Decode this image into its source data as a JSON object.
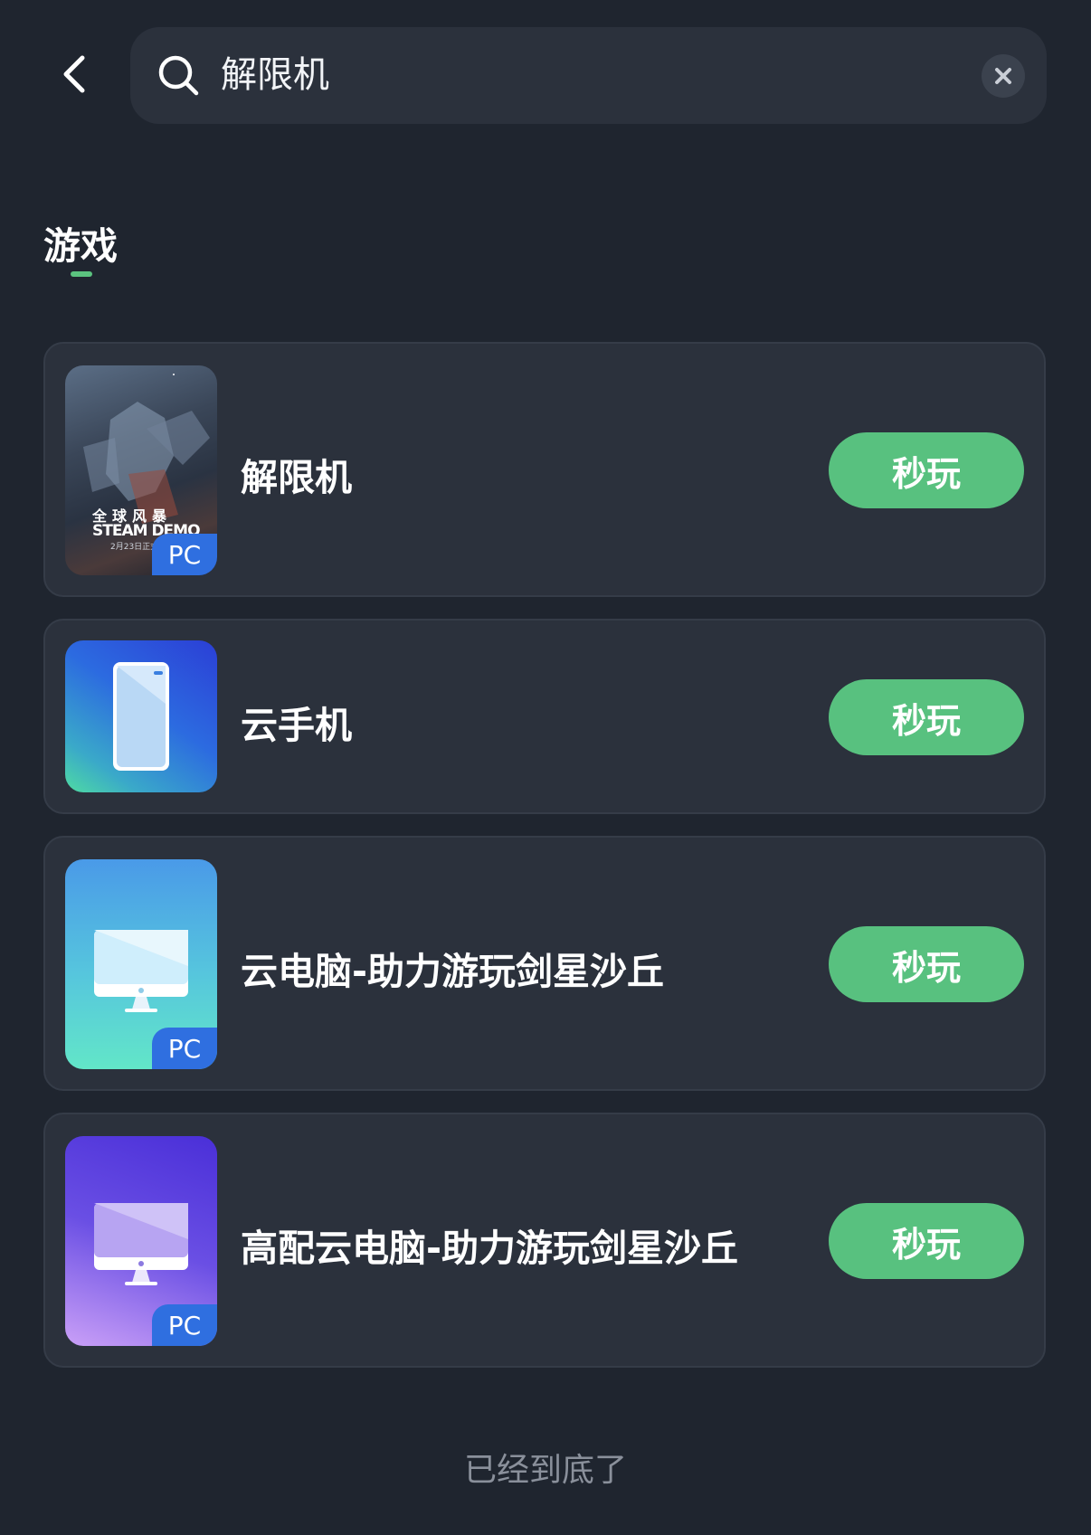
{
  "search": {
    "value": "解限机"
  },
  "tabs": [
    {
      "label": "游戏",
      "active": true
    }
  ],
  "colors": {
    "background": "#1f252f",
    "card": "#2b313c",
    "accent": "#58c17f",
    "pc_badge": "#2f6fe0"
  },
  "results": [
    {
      "name": "解限机",
      "button": "秒玩",
      "badge": "PC",
      "thumb_icon": "game-poster-icon",
      "poster_text": [
        "全球风暴",
        "STEAM DEMO",
        "2月23日正式"
      ]
    },
    {
      "name": "云手机",
      "button": "秒玩",
      "badge": "",
      "thumb_icon": "phone-icon"
    },
    {
      "name": "云电脑-助力游玩剑星沙丘",
      "button": "秒玩",
      "badge": "PC",
      "thumb_icon": "desktop-monitor-icon"
    },
    {
      "name": "高配云电脑-助力游玩剑星沙丘",
      "button": "秒玩",
      "badge": "PC",
      "thumb_icon": "desktop-monitor-icon"
    }
  ],
  "footer": {
    "end_text": "已经到底了"
  }
}
